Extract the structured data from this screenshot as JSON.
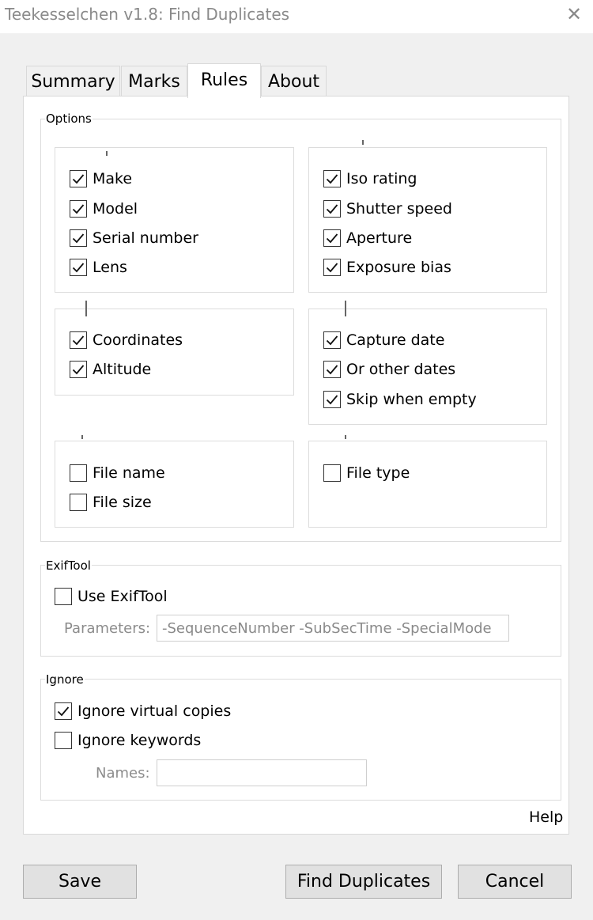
{
  "window": {
    "title": "Teekesselchen v1.8: Find Duplicates",
    "close_glyph": "✕"
  },
  "tabs": [
    {
      "label": "Summary",
      "active": false
    },
    {
      "label": "Marks",
      "active": false
    },
    {
      "label": "Rules",
      "active": true
    },
    {
      "label": "About",
      "active": false
    }
  ],
  "options": {
    "label": "Options",
    "camera": [
      {
        "label": "Make",
        "checked": true
      },
      {
        "label": "Model",
        "checked": true
      },
      {
        "label": "Serial number",
        "checked": true
      },
      {
        "label": "Lens",
        "checked": true
      }
    ],
    "exposure": [
      {
        "label": "Iso rating",
        "checked": true
      },
      {
        "label": "Shutter speed",
        "checked": true
      },
      {
        "label": "Aperture",
        "checked": true
      },
      {
        "label": "Exposure bias",
        "checked": true
      }
    ],
    "location": [
      {
        "label": "Coordinates",
        "checked": true
      },
      {
        "label": "Altitude",
        "checked": true
      }
    ],
    "dates": [
      {
        "label": "Capture date",
        "checked": true
      },
      {
        "label": "Or other dates",
        "checked": true
      },
      {
        "label": "Skip when empty",
        "checked": true
      }
    ],
    "file": [
      {
        "label": "File name",
        "checked": false
      },
      {
        "label": "File size",
        "checked": false
      }
    ],
    "type": [
      {
        "label": "File type",
        "checked": false
      }
    ]
  },
  "exiftool": {
    "label": "ExifTool",
    "use": {
      "label": "Use ExifTool",
      "checked": false
    },
    "parameters_label": "Parameters:",
    "parameters_value": "-SequenceNumber -SubSecTime -SpecialMode"
  },
  "ignore": {
    "label": "Ignore",
    "virtual_copies": {
      "label": "Ignore virtual copies",
      "checked": true
    },
    "keywords": {
      "label": "Ignore keywords",
      "checked": false
    },
    "names_label": "Names:",
    "names_value": ""
  },
  "help_label": "Help",
  "buttons": {
    "save": "Save",
    "find": "Find Duplicates",
    "cancel": "Cancel"
  }
}
